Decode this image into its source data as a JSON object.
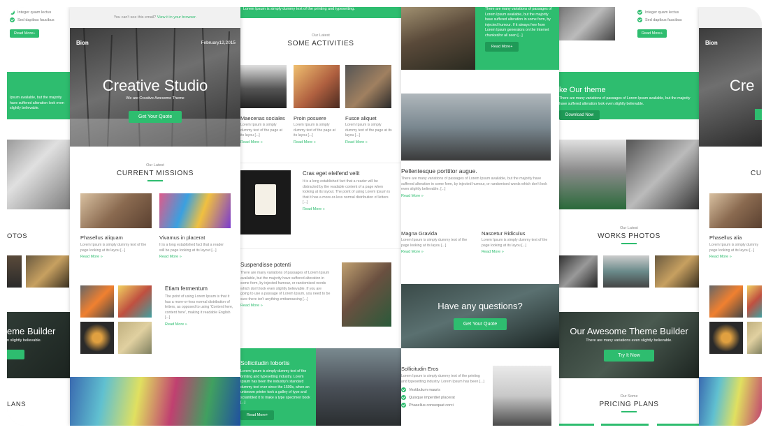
{
  "col1": {
    "view_note": "You can't see this email?",
    "view_link": "View it in your browser.",
    "logo": "Bion",
    "date": "February12,2015",
    "hero_title": "Creative Studio",
    "hero_sub": "We are Creative Awesome Theme",
    "hero_btn": "Get Your Quote",
    "missions_eyebrow": "Our Latest",
    "missions_title": "CURRENT MISSIONS",
    "card1_title": "Phasellus aliquam",
    "card1_text": "Lorem Ipsum is simply dummy text of the page looking at its layou [...]",
    "card2_title": "Vivamus in placerat",
    "card2_text": "It is a long established fact that a reader will be page looking at its layout [...]",
    "read_more": "Read More »",
    "etiam_title": "Etiam fermentum",
    "etiam_text": "The point of using Lorem Ipsum is that it has a more-or-less normal distribution of letters, as opposed to using 'Content here, content here', making it readable English [...]"
  },
  "col2": {
    "top_strip": "Lorem Ipsum is simply dummy text of the printing and typesetting.",
    "eyebrow": "Our Latest",
    "title": "SOME ACTIVITIES",
    "a1_title": "Maecenas sociales",
    "a1_text": "Lorem Ipsum is simply dummy text of the page at its layou [...]",
    "a2_title": "Proin posuere",
    "a2_text": "Lorem Ipsum is simply dummy text of the page at its layou [...]",
    "a3_title": "Fusce aliquet",
    "a3_text": "Lorem Ipsum is simply dummy text of the page at its layou [...]",
    "read_more": "Read More »",
    "cras_title": "Cras eget eleifend velit",
    "cras_text": "It is a long established fact that a reader will be distracted by the readable content of a page when looking at its layout. The point of using Lorem Ipsum is that it has a more-or-less normal distribution of letters [...]",
    "susp_title": "Suspendisse potenti",
    "susp_text": "There are many variations of passages of Lorem Ipsum available, but the majority have suffered alteration in some form, by injected humour, or randomised words which don't look even slightly believable. If you are going to use a passage of Lorem Ipsum, you need to be sure there isn't anything embarrassing [...]",
    "soll_title": "Sollicitudin lobortis",
    "soll_text": "Lorem Ipsum is simply dummy text of the printing and typesetting industry. Lorem Ipsum has been the industry's standard dummy text ever since the 1500s, when an unknown printer took a galley of type and scrambled it to make a type specimen book [...]",
    "soll_btn": "Read More+"
  },
  "col3": {
    "green_text": "There are many variations of passages of Lorem Ipsum available, but the majority have suffered alteration in some form, by injected humour. If it always free from Lorem Ipsum generators on the Internet chunked/or all seen [...]",
    "green_btn": "Read More+",
    "pell_title": "Pellentesque porttitor augue.",
    "pell_text": "There are many variations of passages of Lorem Ipsum available, but the majority have suffered alteration in some form, by injected humour, or randomised words which don't look even slightly believable. [...]",
    "read_more": "Read More »",
    "magna_title": "Magna Gravida",
    "magna_text": "Lorem Ipsum is simply dummy text of the page looking at its layou [...]",
    "nasc_title": "Nascetur Ridiculus",
    "nasc_text": "Lorem Ipsum is simply dummy text of the page looking at its layou [...]",
    "q_title": "Have any questions?",
    "q_btn": "Get Your Quote",
    "sol_title": "Sollicitudin Eros",
    "sol_text": "Lorem Ipsum is simply dummy text of the printing and typesetting industry. Lorem Ipsum has been [...]",
    "check1": "Vestibulum mauris",
    "check2": "Quisque imperdiet placerat",
    "check3": "Phasellus consequat corci"
  },
  "col4": {
    "check1": "Integer quam lectus",
    "check2": "Sed dapibus faucibus",
    "read_more_btn": "Read More+",
    "banner_title": "ke Our theme",
    "banner_text": "There are many variations of passages of Lorem Ipsum available, but the majority have suffered alteration look even slightly believable.",
    "banner_btn": "Download Now",
    "works_eyebrow": "Our Latest",
    "works_title": "WORKS PHOTOS",
    "builder_title": "Our Awesome Theme Builder",
    "builder_sub": "There are many variations even slightly believable.",
    "builder_btn": "Try It Now",
    "pricing_eyebrow": "Our Some",
    "pricing_title": "PRICING PLANS"
  },
  "left_edge": {
    "check1": "Integer quam lectus",
    "check2": "Sed dapibus faucibus",
    "btn": "Read More+",
    "banner_text": "Ipsum available, but the majority have suffered alteration look even slightly believable.",
    "photos": "OTOS",
    "builder": "eme Builder",
    "builder_sub": "n slightly believable.",
    "plans": "LANS"
  },
  "right_edge": {
    "logo": "Bion",
    "hero": "Cre",
    "cu": "CU",
    "card_title": "Phasellus alia",
    "card_text": "Lorem Ipsum is simply dummy page looking at its layou [...]",
    "read_more": "Read More »"
  },
  "colors": {
    "accent": "#2ebd6f",
    "accent_dark": "#1f9a57",
    "text": "#333333",
    "muted": "#888888"
  }
}
